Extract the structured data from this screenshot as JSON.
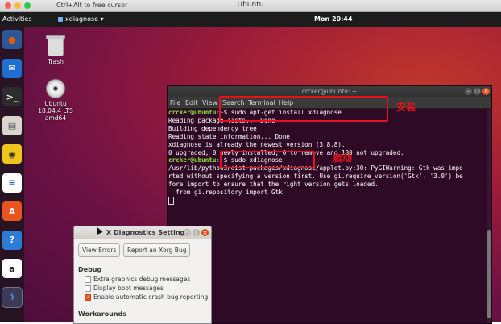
{
  "vm_window": {
    "title": "Ubuntu",
    "hint": "Ctrl+Alt to free cursor"
  },
  "topbar": {
    "activities": "Activities",
    "app_name": "xdiagnose",
    "clock": "Mon 20:44"
  },
  "dock": [
    {
      "name": "firefox-icon",
      "glyph": "●",
      "color": "#e66000",
      "bg": "#2b5797"
    },
    {
      "name": "thunderbird-icon",
      "glyph": "✉",
      "color": "#ffffff",
      "bg": "#1f6fd0"
    },
    {
      "name": "terminal-icon",
      "glyph": ">_",
      "color": "#ffffff",
      "bg": "#2c2c2c"
    },
    {
      "name": "files-icon",
      "glyph": "▤",
      "color": "#555555",
      "bg": "#d9d4cc"
    },
    {
      "name": "rhythmbox-icon",
      "glyph": "◉",
      "color": "#333333",
      "bg": "#f0c419"
    },
    {
      "name": "writer-icon",
      "glyph": "≡",
      "color": "#1f5fb0",
      "bg": "#ffffff"
    },
    {
      "name": "software-icon",
      "glyph": "A",
      "color": "#ffffff",
      "bg": "#e95420"
    },
    {
      "name": "help-icon",
      "glyph": "?",
      "color": "#ffffff",
      "bg": "#2e7bd6"
    },
    {
      "name": "amazon-icon",
      "glyph": "a",
      "color": "#222222",
      "bg": "#ffffff"
    },
    {
      "name": "xdiagnose-icon",
      "glyph": "⚕",
      "color": "#6fb3ff",
      "bg": "#3a3a5a"
    }
  ],
  "desktop_icons": {
    "trash": "Trash",
    "cd_lines": [
      "Ubuntu",
      "18.04.4 LTS",
      "amd64"
    ]
  },
  "terminal": {
    "title": "crcker@ubuntu: ~",
    "menu": [
      "File",
      "Edit",
      "View",
      "Search",
      "Terminal",
      "Help"
    ],
    "lines": [
      {
        "user": "crcker@ubuntu",
        "path": ":~",
        "text": "$ sudo apt-get install xdiagnose"
      },
      {
        "text": "Reading package lists... Done"
      },
      {
        "text": "Building dependency tree"
      },
      {
        "text": "Reading state information... Done"
      },
      {
        "text": "xdiagnose is already the newest version (3.8.8)."
      },
      {
        "text": "0 upgraded, 0 newly installed, 0 to remove and 180 not upgraded."
      },
      {
        "user": "crcker@ubuntu",
        "path": ":~",
        "text": "$ sudo xdiagnose"
      },
      {
        "text": "/usr/lib/python3/dist-packages/xdiagnose/applet.py:30: PyGIWarning: Gtk was impo"
      },
      {
        "text": "rted without specifying a version first. Use gi.require_version('Gtk', '3.0') be"
      },
      {
        "text": "fore import to ensure that the right version gets loaded."
      },
      {
        "text": "  from gi.repository import Gtk"
      }
    ]
  },
  "annotations": {
    "install": "安装",
    "launch": "启动"
  },
  "xdiag_window": {
    "title": "X Diagnostics Settings",
    "buttons": [
      "View Errors",
      "Report an Xorg Bug"
    ],
    "debug_title": "Debug",
    "options": [
      {
        "label": "Extra graphics debug messages",
        "checked": false
      },
      {
        "label": "Display boot messages",
        "checked": false
      },
      {
        "label": "Enable automatic crash bug reporting",
        "checked": true
      }
    ],
    "workarounds_title": "Workarounds"
  },
  "colors": {
    "accent": "#e95420",
    "annotation_red": "#e8101b",
    "terminal_bg": "#2f0a26"
  }
}
